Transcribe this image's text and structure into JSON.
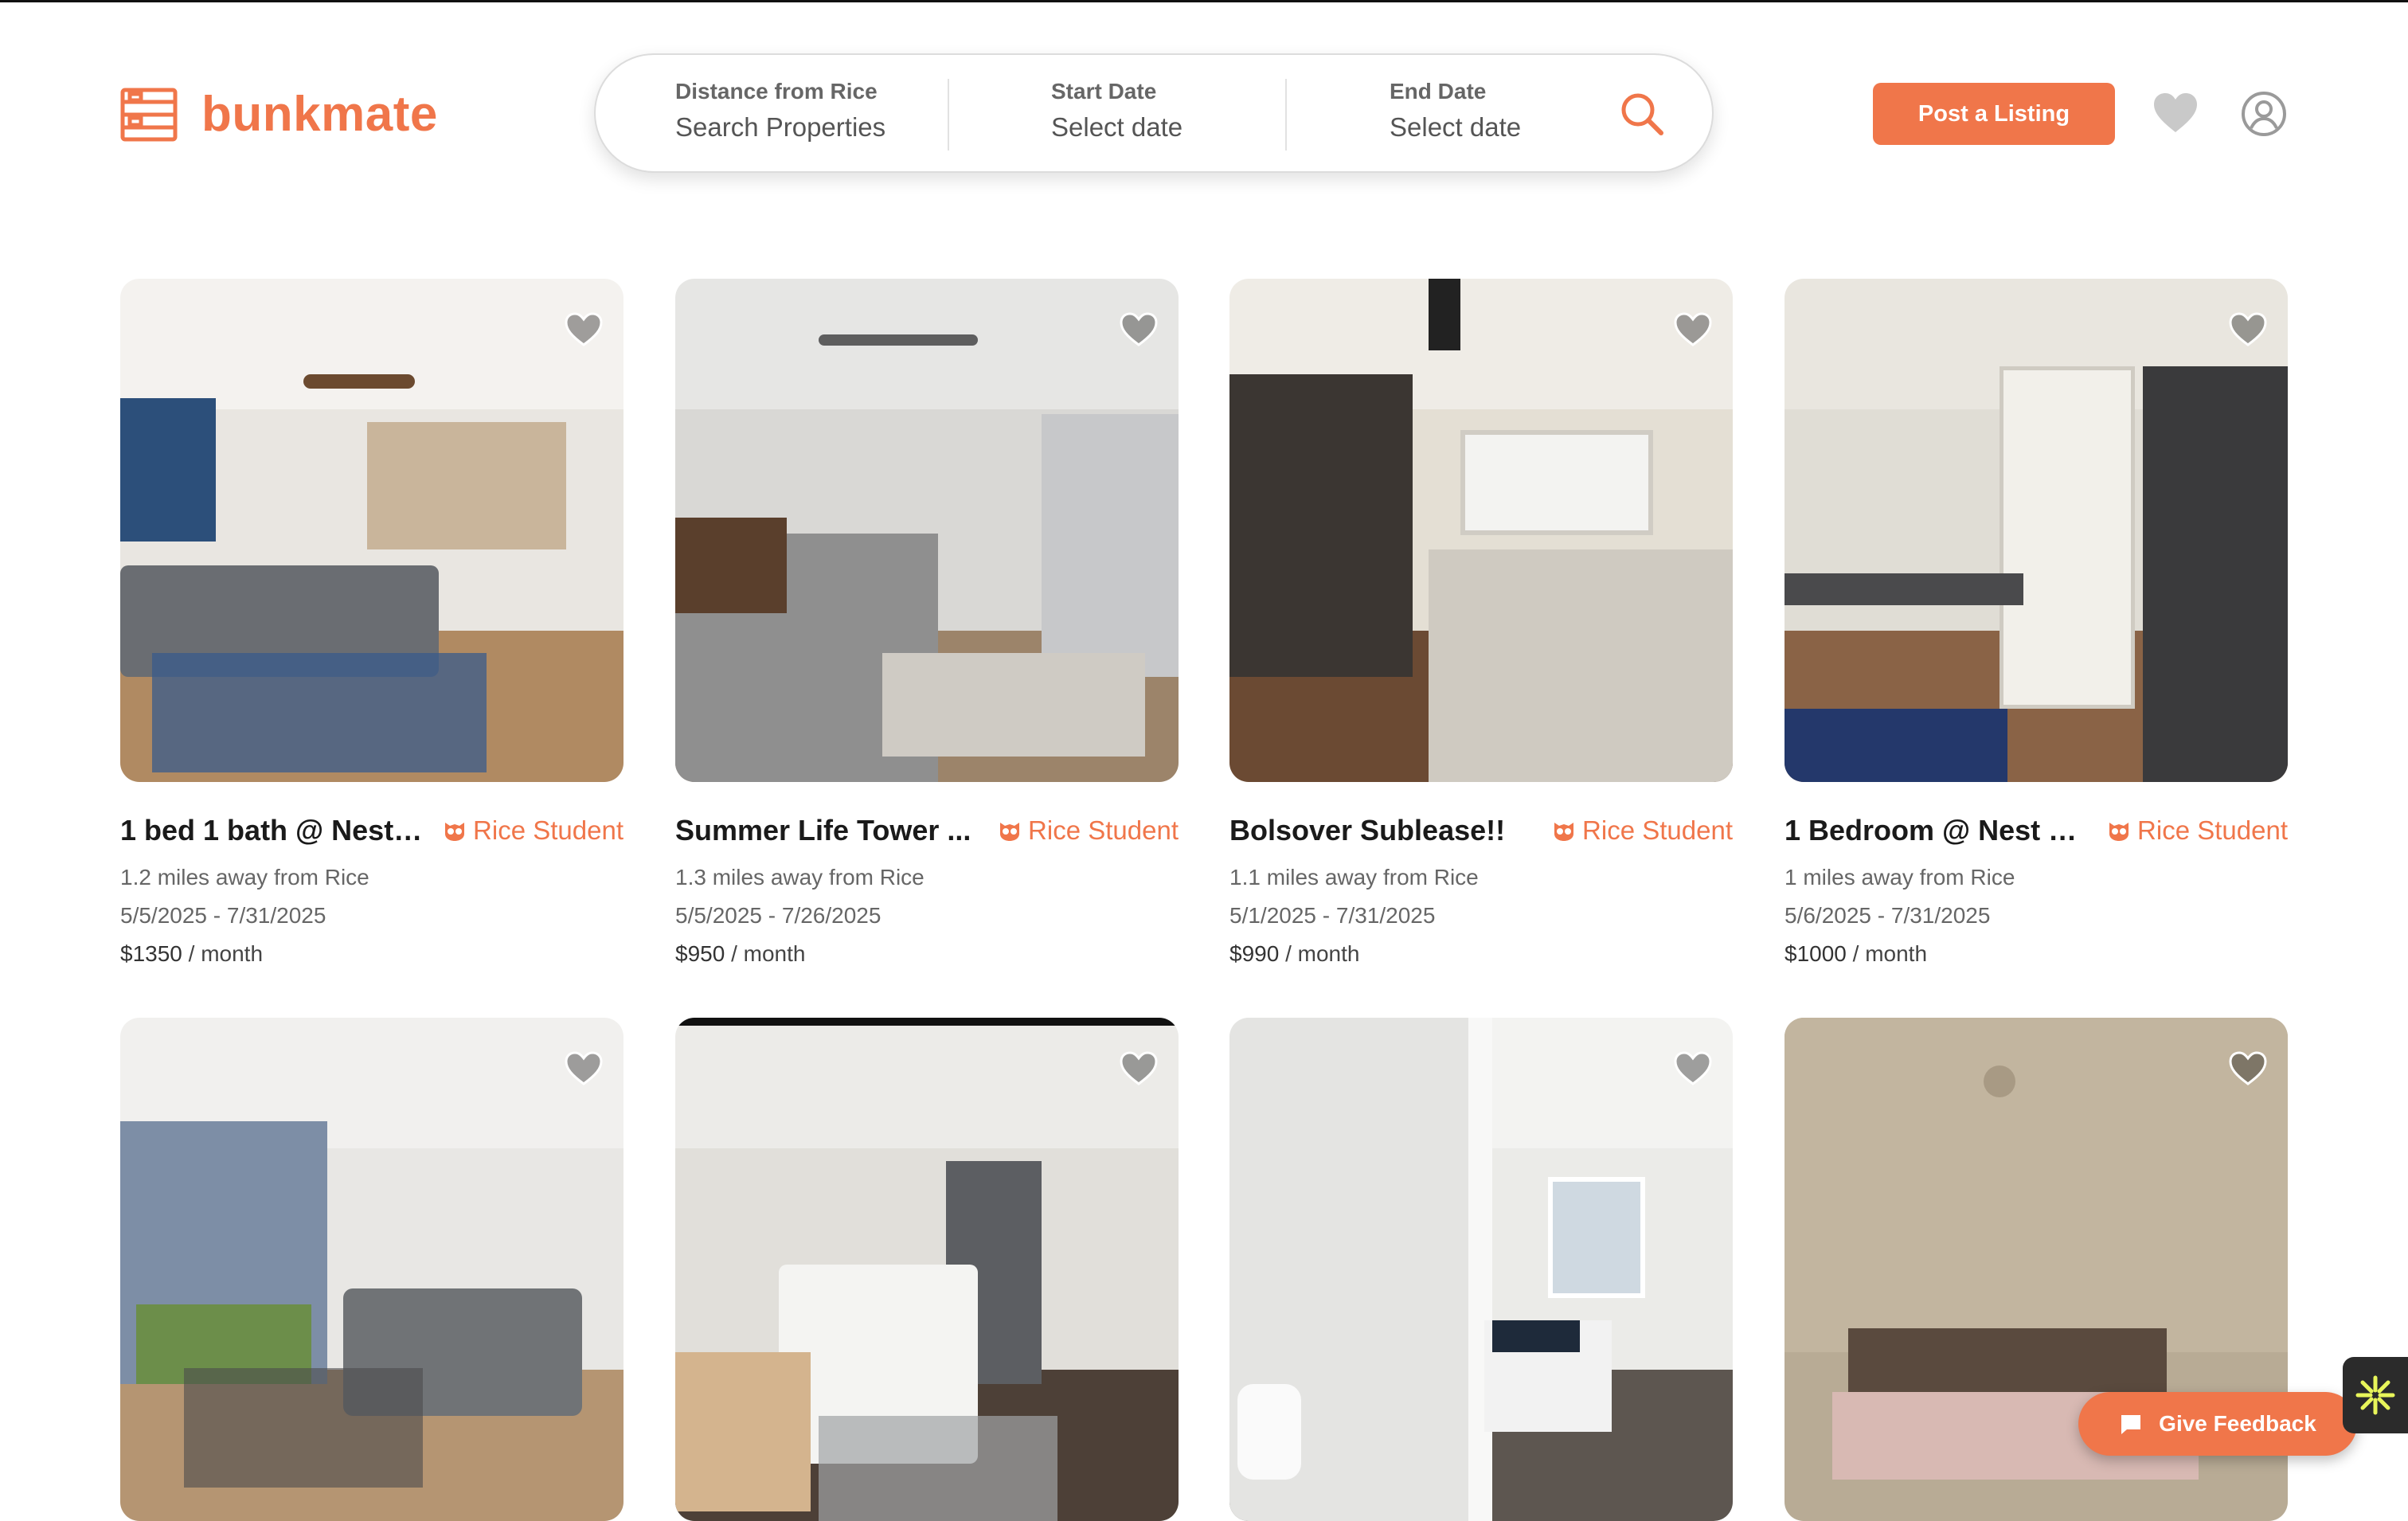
{
  "brand": {
    "name": "bunkmate",
    "color": "#f0764a"
  },
  "search": {
    "distance_label": "Distance from Rice",
    "distance_placeholder": "Search Properties",
    "start_label": "Start Date",
    "start_placeholder": "Select date",
    "end_label": "End Date",
    "end_placeholder": "Select date"
  },
  "header": {
    "post_label": "Post a Listing"
  },
  "listings": [
    {
      "title": "1 bed 1 bath @ Nest ...",
      "badge": "Rice Student",
      "distance": "1.2 miles away from Rice",
      "dates": "5/5/2025 - 7/31/2025",
      "price": "$1350",
      "per": " / month"
    },
    {
      "title": "Summer Life Tower ...",
      "badge": "Rice Student",
      "distance": "1.3 miles away from Rice",
      "dates": "5/5/2025 - 7/26/2025",
      "price": "$950",
      "per": " / month"
    },
    {
      "title": "Bolsover Sublease!!",
      "badge": "Rice Student",
      "distance": "1.1 miles away from Rice",
      "dates": "5/1/2025 - 7/31/2025",
      "price": "$990",
      "per": " / month"
    },
    {
      "title": "1 Bedroom @ Nest o...",
      "badge": "Rice Student",
      "distance": "1 miles away from Rice",
      "dates": "5/6/2025 - 7/31/2025",
      "price": "$1000",
      "per": " / month"
    },
    {
      "title": "",
      "badge": "",
      "distance": "",
      "dates": "",
      "price": "",
      "per": ""
    },
    {
      "title": "",
      "badge": "",
      "distance": "",
      "dates": "",
      "price": "",
      "per": ""
    },
    {
      "title": "",
      "badge": "",
      "distance": "",
      "dates": "",
      "price": "",
      "per": ""
    },
    {
      "title": "",
      "badge": "",
      "distance": "",
      "dates": "",
      "price": "",
      "per": ""
    }
  ],
  "feedback": {
    "label": "Give Feedback"
  },
  "icons": {
    "logo": "bunk-bed-icon",
    "search": "search-icon",
    "favorites": "heart-icon",
    "account": "user-circle-icon",
    "badge": "owl-icon",
    "feedback": "chat-bubble-icon",
    "widget": "asterisk-icon"
  }
}
